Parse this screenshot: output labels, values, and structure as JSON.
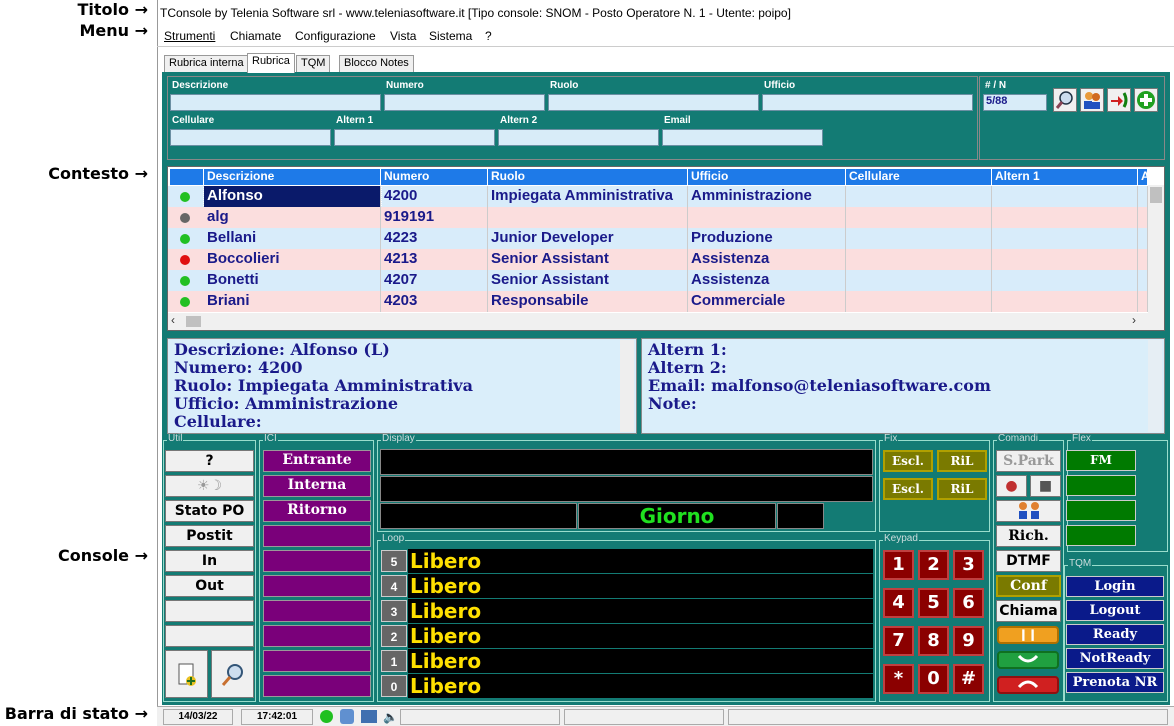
{
  "annotations": {
    "titolo": "Titolo →",
    "menu": "Menu →",
    "contesto": "Contesto →",
    "console": "Console →",
    "barra": "Barra di stato →"
  },
  "window": {
    "title": "TConsole by Telenia Software srl - www.teleniasoftware.it    [Tipo console: SNOM - Posto Operatore N. 1 - Utente: poipo]"
  },
  "menu": [
    "Strumenti",
    "Chiamate",
    "Configurazione",
    "Vista",
    "Sistema",
    "?"
  ],
  "tabs": [
    "Rubrica interna",
    "Rubrica",
    "TQM",
    "Blocco Notes"
  ],
  "search": {
    "descrizione": "Descrizione",
    "numero": "Numero",
    "ruolo": "Ruolo",
    "ufficio": "Ufficio",
    "cellulare": "Cellulare",
    "altern1": "Altern 1",
    "altern2": "Altern 2",
    "email": "Email",
    "count_label": "# / N",
    "count_value": "5/88"
  },
  "grid": {
    "headers": [
      "Descrizione",
      "Numero",
      "Ruolo",
      "Ufficio",
      "Cellulare",
      "Altern 1",
      "A"
    ],
    "rows": [
      {
        "status": "#22c022",
        "descrizione": "Alfonso",
        "numero": "4200",
        "ruolo": "Impiegata Amministrativa",
        "ufficio": "Amministrazione"
      },
      {
        "status": "#666666",
        "descrizione": "alg",
        "numero": "919191",
        "ruolo": "",
        "ufficio": ""
      },
      {
        "status": "#22c022",
        "descrizione": "Bellani",
        "numero": "4223",
        "ruolo": "Junior Developer",
        "ufficio": "Produzione"
      },
      {
        "status": "#e01010",
        "descrizione": "Boccolieri",
        "numero": "4213",
        "ruolo": "Senior Assistant",
        "ufficio": "Assistenza"
      },
      {
        "status": "#22c022",
        "descrizione": "Bonetti",
        "numero": "4207",
        "ruolo": "Senior Assistant",
        "ufficio": "Assistenza"
      },
      {
        "status": "#22c022",
        "descrizione": "Briani",
        "numero": "4203",
        "ruolo": "Responsabile",
        "ufficio": "Commerciale"
      }
    ]
  },
  "detail_left": [
    "Descrizione: Alfonso (L)",
    "Numero: 4200",
    "Ruolo: Impiegata Amministrativa",
    "Ufficio: Amministrazione",
    "Cellulare:"
  ],
  "detail_right": [
    "Altern 1:",
    "Altern 2:",
    "Email: malfonso@teleniasoftware.com",
    "Note:"
  ],
  "console": {
    "groups": {
      "util": "Util",
      "ici": "ICI",
      "display": "Display",
      "fix": "Fix",
      "comandi": "Comandi",
      "flex": "Flex",
      "loop": "Loop",
      "keypad": "Keypad",
      "tqm": "TQM"
    },
    "util": [
      "?",
      "",
      "Stato PO",
      "Postit",
      "In",
      "Out"
    ],
    "ici": [
      "Entrante",
      "Interna",
      "Ritorno"
    ],
    "display_mode": "Giorno",
    "fix": [
      "Escl.",
      "RiL",
      "Escl.",
      "RiL"
    ],
    "comandi": [
      "S.Park",
      "Rich.",
      "DTMF",
      "Conf",
      "Chiama"
    ],
    "flex": [
      "FM"
    ],
    "loop": [
      {
        "n": "5",
        "v": "Libero"
      },
      {
        "n": "4",
        "v": "Libero"
      },
      {
        "n": "3",
        "v": "Libero"
      },
      {
        "n": "2",
        "v": "Libero"
      },
      {
        "n": "1",
        "v": "Libero"
      },
      {
        "n": "0",
        "v": "Libero"
      }
    ],
    "keypad": [
      "1",
      "2",
      "3",
      "4",
      "5",
      "6",
      "7",
      "8",
      "9",
      "*",
      "0",
      "#"
    ],
    "tqm": [
      "Login",
      "Logout",
      "Ready",
      "NotReady",
      "Prenota NR"
    ]
  },
  "status": {
    "date": "14/03/22",
    "time": "17:42:01"
  }
}
